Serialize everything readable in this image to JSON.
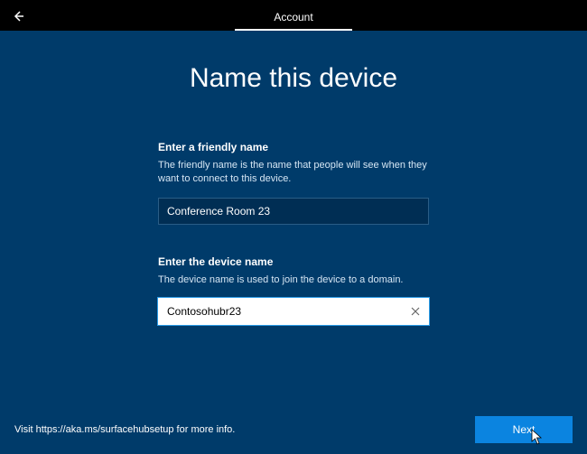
{
  "header": {
    "tab_label": "Account"
  },
  "page": {
    "title": "Name this device"
  },
  "friendly": {
    "label": "Enter a friendly name",
    "help": "The friendly name is the name that people will see when they want to connect to this device.",
    "value": "Conference Room 23"
  },
  "device": {
    "label": "Enter the device name",
    "help": "The device name is used to join the device to a domain.",
    "value": "Contosohubr23"
  },
  "footer": {
    "info": "Visit https://aka.ms/surfacehubsetup for more info.",
    "next_label": "Next"
  }
}
